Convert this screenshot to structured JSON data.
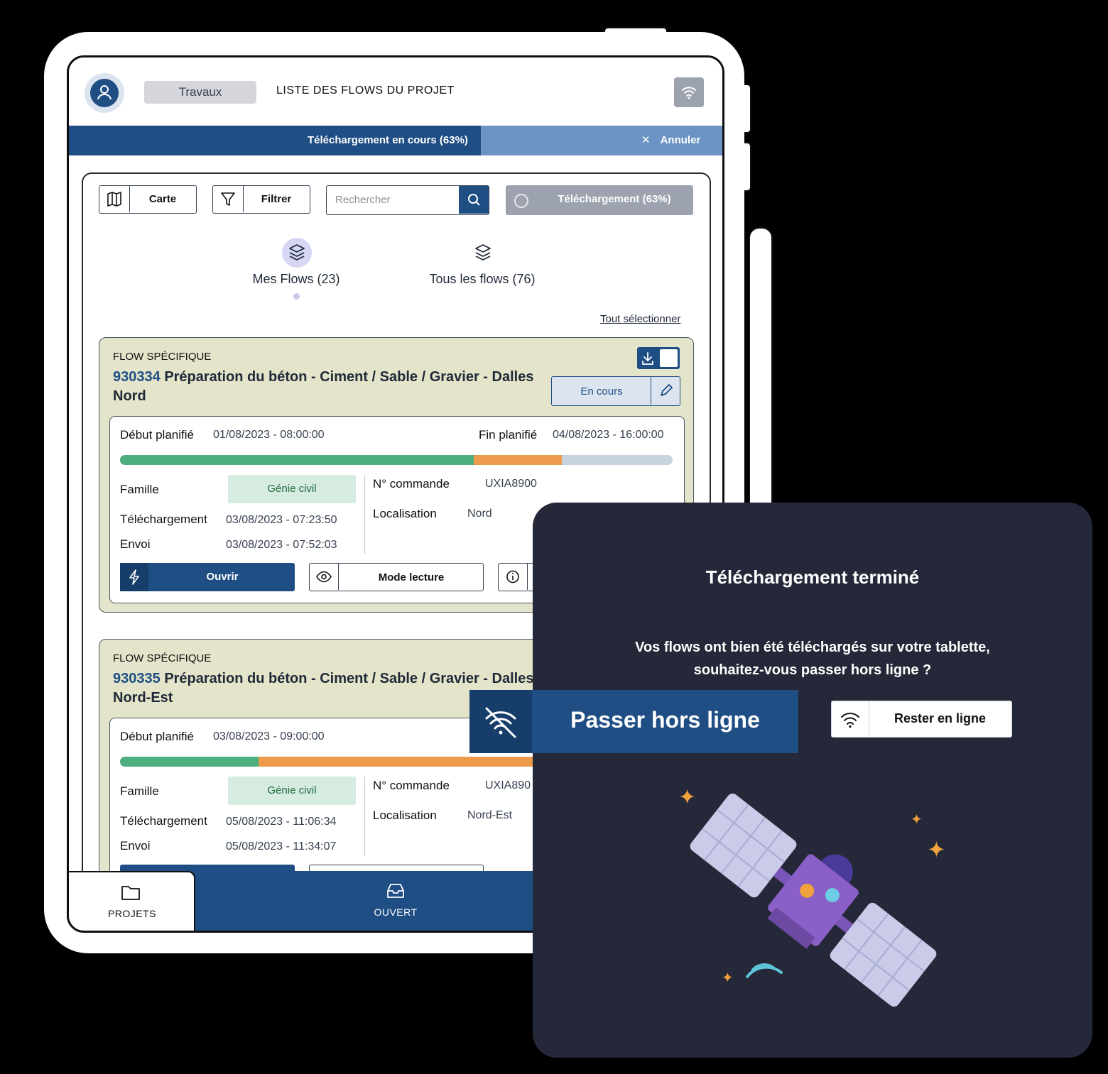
{
  "header": {
    "tag": "Travaux",
    "title": "LISTE DES FLOWS DU PROJET"
  },
  "progress": {
    "label": "Téléchargement en cours (63%)",
    "value": 0.63,
    "cancel": "Annuler"
  },
  "toolbar": {
    "map": "Carte",
    "filter": "Filtrer",
    "search_placeholder": "Rechercher",
    "download": "Téléchargement (63%)"
  },
  "tabs": [
    {
      "label": "Mes Flows (23)",
      "active": true
    },
    {
      "label": "Tous les flows (76)",
      "active": false
    }
  ],
  "select_all": "Tout sélectionner",
  "flows": [
    {
      "kind": "FLOW SPÉCIFIQUE",
      "number": "930334",
      "title": "Préparation du béton - Ciment / Sable / Gravier - Dalles Nord",
      "status": "En cours",
      "start_label": "Début planifié",
      "start": "01/08/2023 - 08:00:00",
      "end_label": "Fin planifié",
      "end": "04/08/2023 - 16:00:00",
      "progress_done": 0.64,
      "progress_late": 0.16,
      "famille_label": "Famille",
      "famille": "Génie civil",
      "dl_label": "Téléchargement",
      "dl": "03/08/2023 - 07:23:50",
      "envoi_label": "Envoi",
      "envoi": "03/08/2023 - 07:52:03",
      "order_label": "N° commande",
      "order": "UXIA8900",
      "loc_label": "Localisation",
      "loc": "Nord",
      "open": "Ouvrir",
      "read": "Mode lecture"
    },
    {
      "kind": "FLOW SPÉCIFIQUE",
      "number": "930335",
      "title": "Préparation du béton - Ciment / Sable / Gravier - Dalles Nord-Est",
      "start_label": "Début planifié",
      "start": "03/08/2023 - 09:00:00",
      "progress_done": 0.25,
      "progress_late": 0.75,
      "famille_label": "Famille",
      "famille": "Génie civil",
      "dl_label": "Téléchargement",
      "dl": "05/08/2023 - 11:06:34",
      "envoi_label": "Envoi",
      "envoi": "05/08/2023 - 11:34:07",
      "order_label": "N° commande",
      "order": "UXIA890",
      "loc_label": "Localisation",
      "loc": "Nord-Est"
    }
  ],
  "nav": {
    "projects": "PROJETS",
    "open": "OUVERT"
  },
  "modal": {
    "title": "Téléchargement terminé",
    "message_line1": "Vos flows ont bien été téléchargés sur votre tablette,",
    "message_line2": "souhaitez-vous passer hors ligne ?",
    "offline_button": "Passer hors ligne",
    "online_button": "Rester en ligne"
  },
  "colors": {
    "brand": "#1f4e85",
    "card_bg": "#e3e4c9",
    "modal_bg": "#252838",
    "progress_green": "#4caf7d",
    "progress_orange": "#ec9a4b"
  }
}
